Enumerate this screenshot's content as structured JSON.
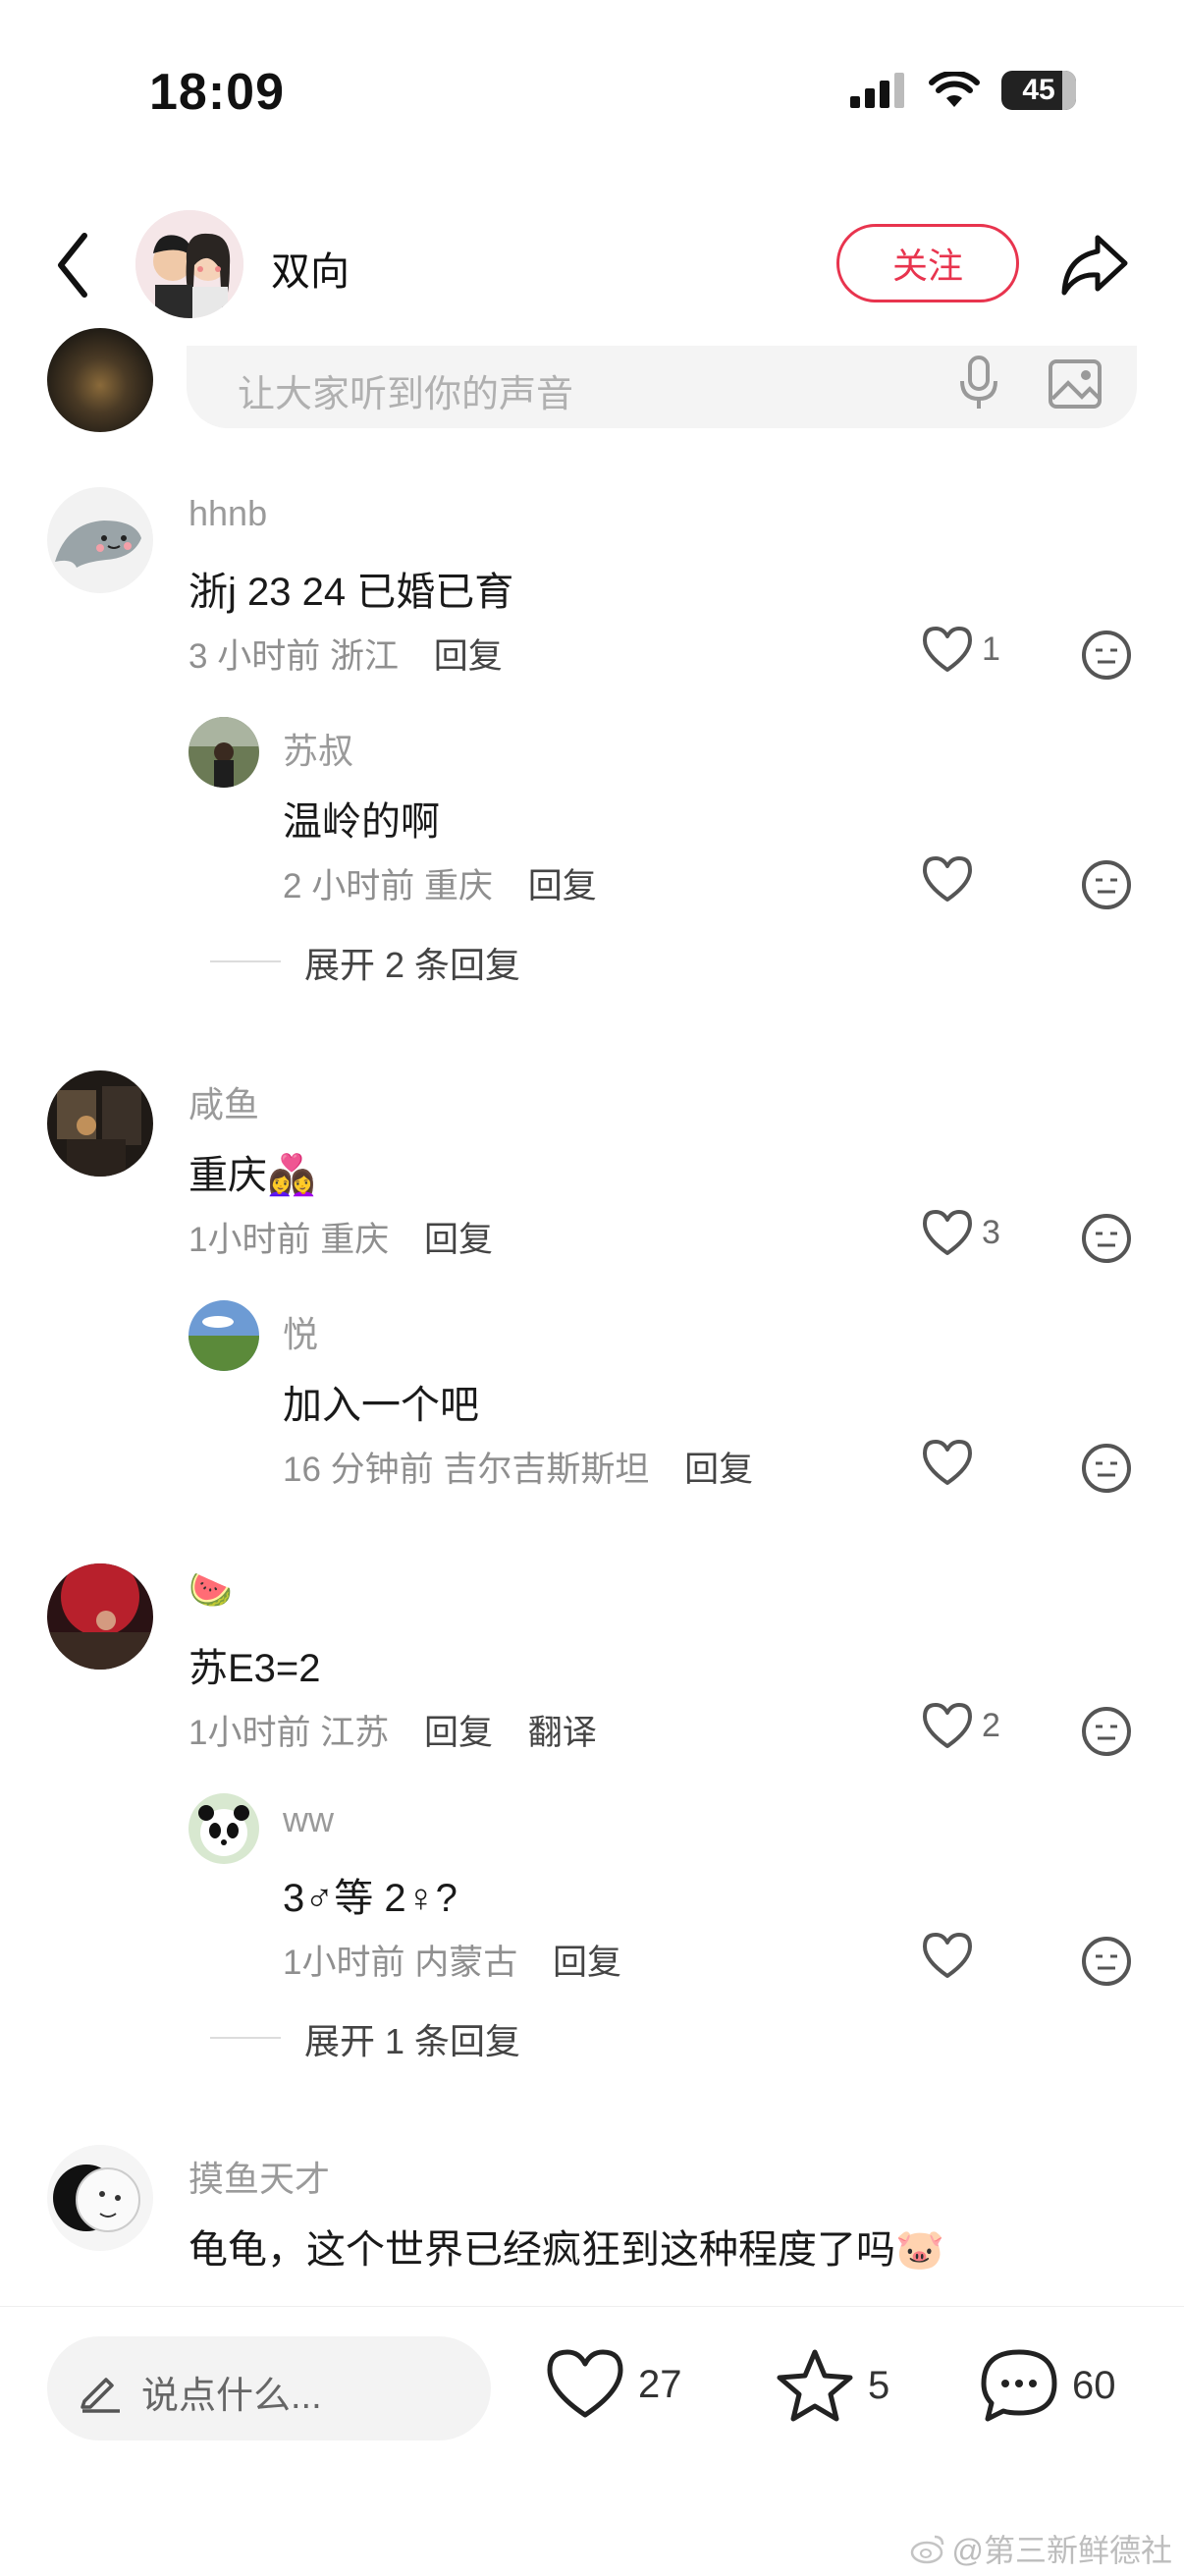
{
  "status_bar": {
    "time": "18:09",
    "battery": "45"
  },
  "header": {
    "user_name": "双向",
    "follow_label": "关注"
  },
  "comment_input": {
    "placeholder": "让大家听到你的声音"
  },
  "comments": [
    {
      "user": "hhnb",
      "text": "浙j 23 24 已婚已育",
      "time": "3 小时前",
      "location": "浙江",
      "reply_label": "回复",
      "likes": "1",
      "replies": [
        {
          "user": "苏叔",
          "text": "温岭的啊",
          "time": "2 小时前",
          "location": "重庆",
          "reply_label": "回复"
        }
      ],
      "expand": "展开 2 条回复"
    },
    {
      "user": "咸鱼",
      "text": "重庆👩‍❤️‍👩",
      "time": "1小时前",
      "location": "重庆",
      "reply_label": "回复",
      "likes": "3",
      "replies": [
        {
          "user": "悦",
          "text": "加入一个吧",
          "time": "16 分钟前",
          "location": "吉尔吉斯斯坦",
          "reply_label": "回复"
        }
      ]
    },
    {
      "user": "🍉",
      "text": "苏E3=2",
      "time": "1小时前",
      "location": "江苏",
      "reply_label": "回复",
      "translate_label": "翻译",
      "likes": "2",
      "replies": [
        {
          "user": "ww",
          "text": "3♂等 2♀?",
          "time": "1小时前",
          "location": "内蒙古",
          "reply_label": "回复"
        }
      ],
      "expand": "展开 1 条回复"
    },
    {
      "user": "摸鱼天才",
      "text": "龟龟，这个世界已经疯狂到这种程度了吗🐷"
    }
  ],
  "bottom_bar": {
    "say_placeholder": "说点什么...",
    "likes": "27",
    "stars": "5",
    "comments": "60"
  },
  "watermark": "@第三新鲜德社",
  "colors": {
    "accent": "#e8344e"
  }
}
